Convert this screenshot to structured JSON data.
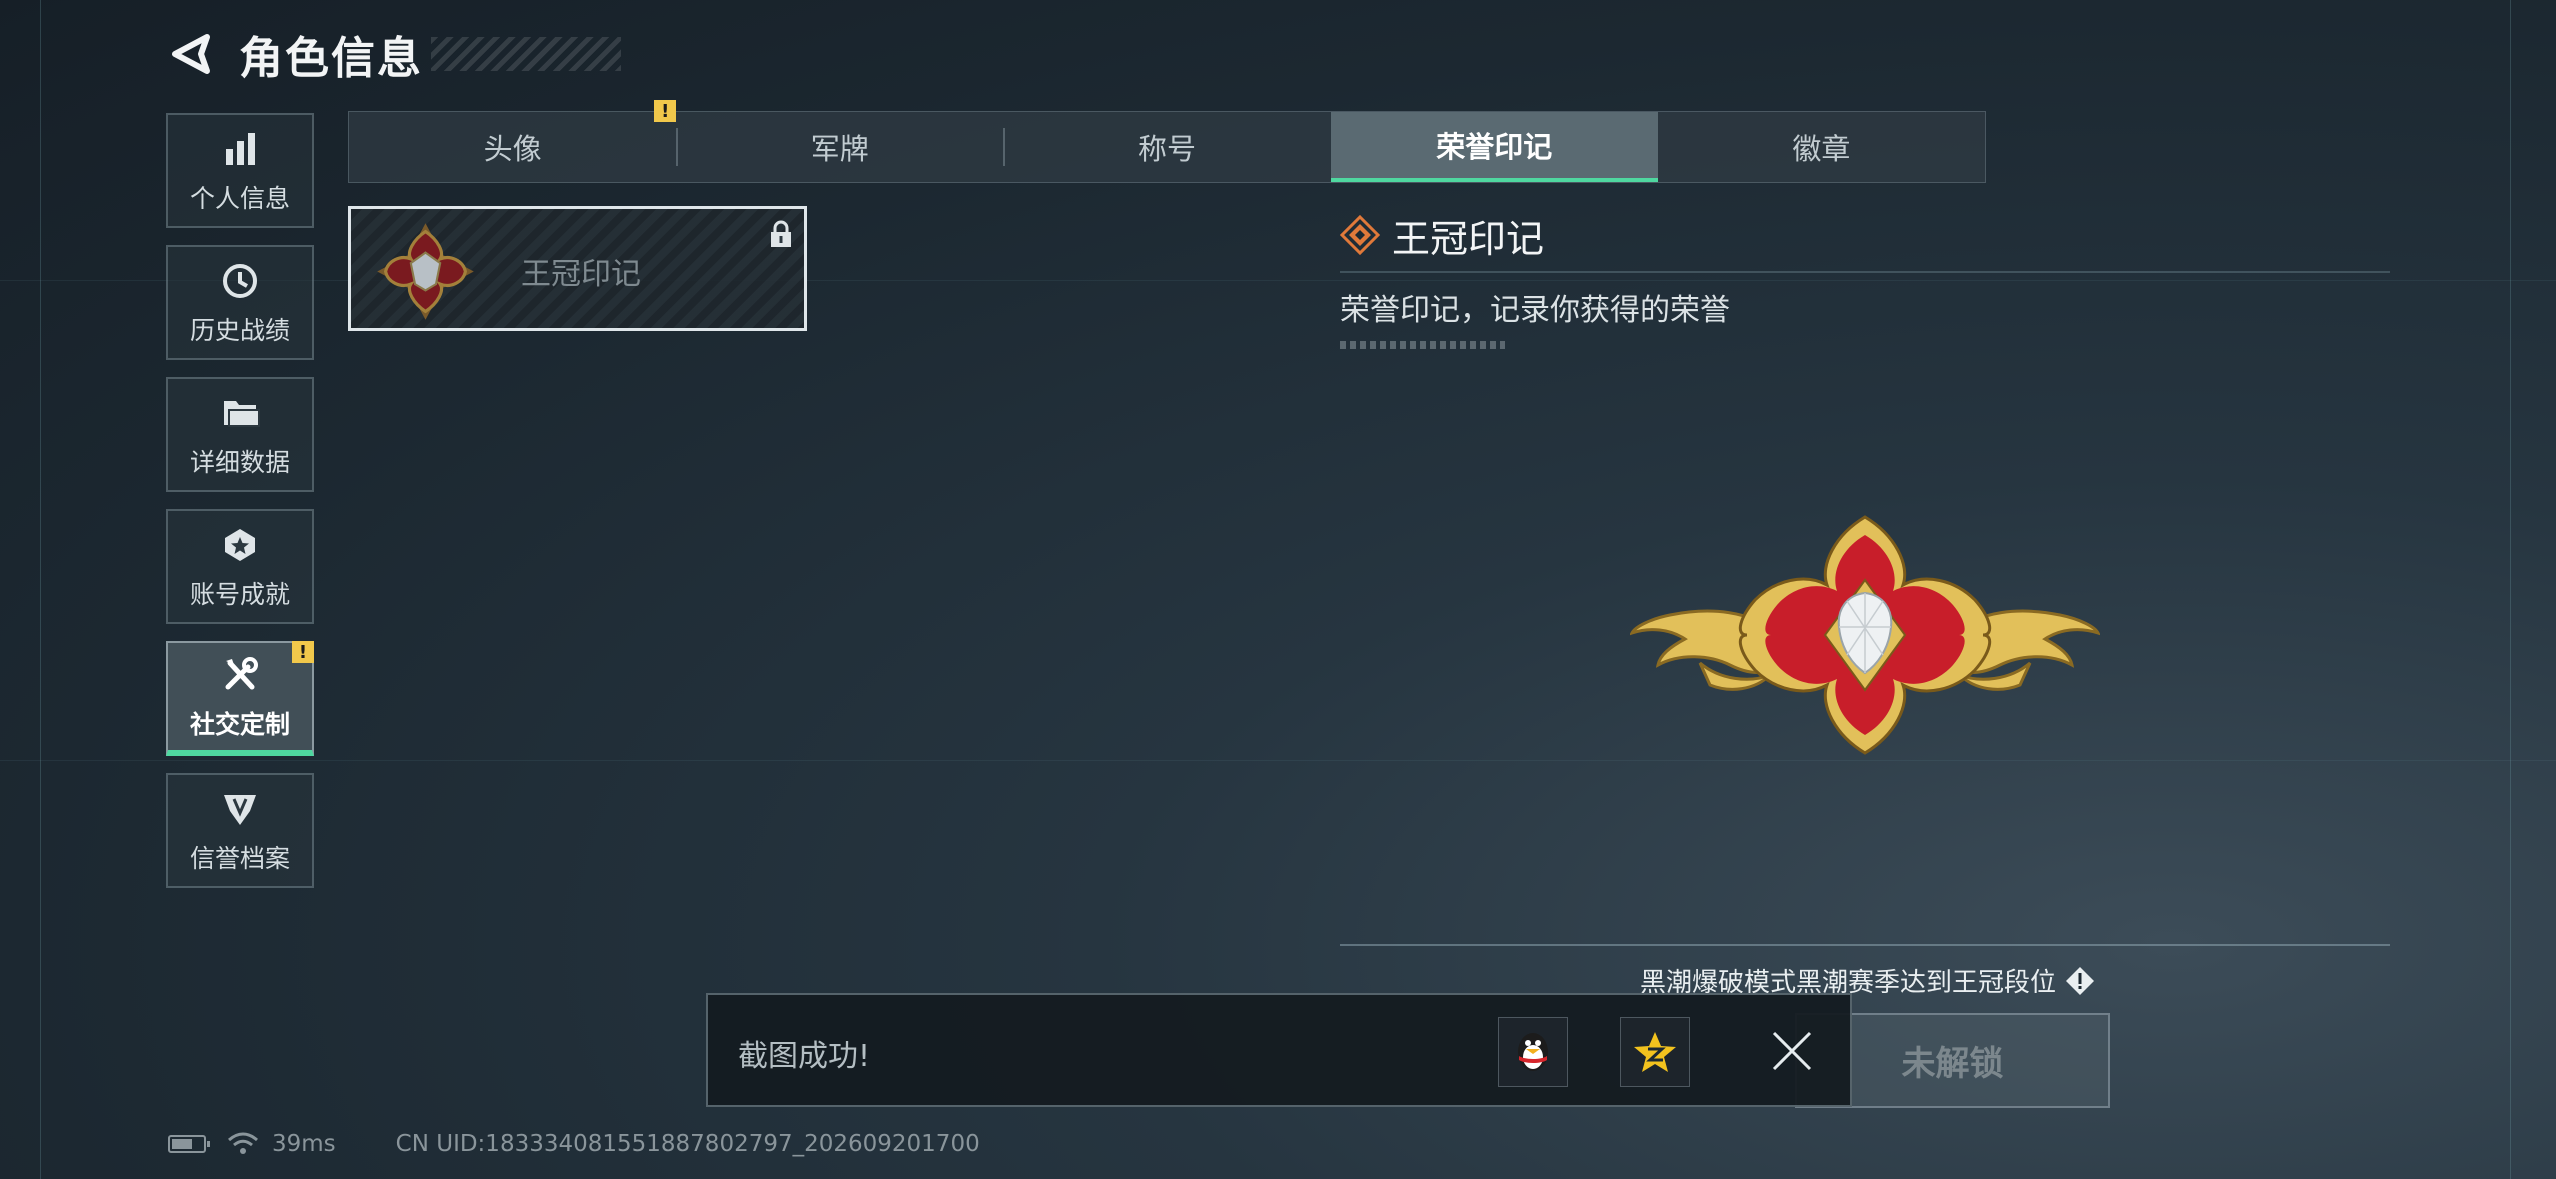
{
  "header": {
    "title": "角色信息"
  },
  "sidebar": {
    "items": [
      {
        "label": "个人信息",
        "icon": "bar-chart-icon"
      },
      {
        "label": "历史战绩",
        "icon": "clock-history-icon"
      },
      {
        "label": "详细数据",
        "icon": "folder-icon"
      },
      {
        "label": "账号成就",
        "icon": "achievement-medal-icon"
      },
      {
        "label": "社交定制",
        "icon": "tools-wrench-icon",
        "active": true,
        "badge": "!"
      },
      {
        "label": "信誉档案",
        "icon": "credit-shield-icon"
      }
    ]
  },
  "tabs": [
    {
      "label": "头像",
      "badge": "!"
    },
    {
      "label": "军牌"
    },
    {
      "label": "称号"
    },
    {
      "label": "荣誉印记",
      "active": true
    },
    {
      "label": "徽章"
    }
  ],
  "seal_list": [
    {
      "name": "王冠印记",
      "locked": true
    }
  ],
  "detail": {
    "name": "王冠印记",
    "description": "荣誉印记，记录你获得的荣誉",
    "condition": "黑潮爆破模式黑潮赛季达到王冠段位",
    "unlock_button": "未解锁"
  },
  "toast": {
    "message": "截图成功!"
  },
  "status": {
    "ping": "39ms",
    "uid": "CN UID:183334081551887802797_202609201700"
  },
  "colors": {
    "accent_green": "#4fd8a0",
    "warn_yellow": "#f1c84b",
    "seal_red": "#c81e2a",
    "seal_gold": "#e2c05a"
  }
}
